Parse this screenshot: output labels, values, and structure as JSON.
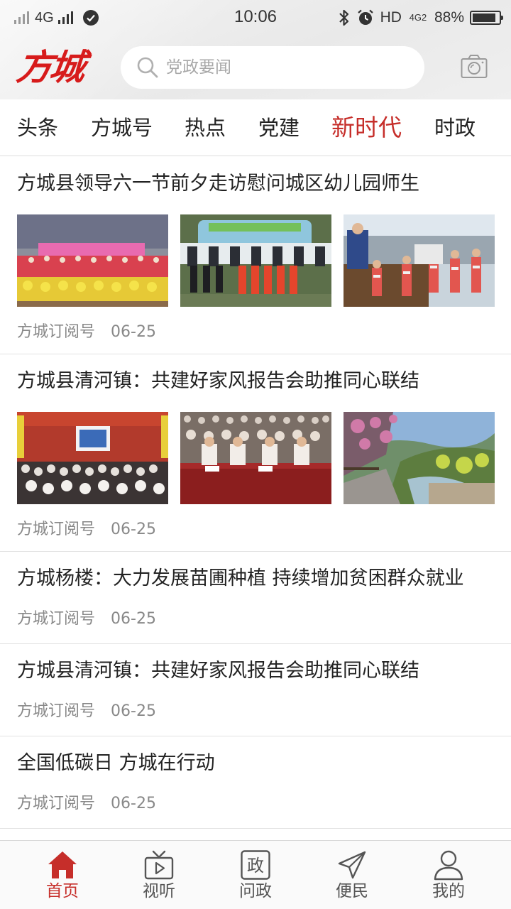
{
  "status_bar": {
    "network": "4G",
    "time": "10:06",
    "hd": "HD",
    "network2": "4G2",
    "battery_pct": "88%",
    "battery_level": 0.88
  },
  "header": {
    "logo": "方城",
    "search_placeholder": "党政要闻"
  },
  "tabs": [
    {
      "label": "头条",
      "active": false
    },
    {
      "label": "方城号",
      "active": false
    },
    {
      "label": "热点",
      "active": false
    },
    {
      "label": "党建",
      "active": false
    },
    {
      "label": "新时代",
      "active": true
    },
    {
      "label": "时政",
      "active": false
    }
  ],
  "articles": [
    {
      "title": "方城县领导六一节前夕走访慰问城区幼儿园师生",
      "source": "方城订阅号",
      "date": "06-25"
    },
    {
      "title": "方城县清河镇：共建好家风报告会助推同心联结",
      "source": "方城订阅号",
      "date": "06-25"
    },
    {
      "title": "方城杨楼：大力发展苗圃种植 持续增加贫困群众就业",
      "source": "方城订阅号",
      "date": "06-25"
    },
    {
      "title": "方城县清河镇：共建好家风报告会助推同心联结",
      "source": "方城订阅号",
      "date": "06-25"
    },
    {
      "title": "全国低碳日 方城在行动",
      "source": "方城订阅号",
      "date": "06-25"
    }
  ],
  "bottom_nav": [
    {
      "label": "首页",
      "icon": "home-icon",
      "active": true
    },
    {
      "label": "视听",
      "icon": "tv-icon",
      "active": false
    },
    {
      "label": "问政",
      "icon": "zheng-icon",
      "icon_text": "政",
      "active": false
    },
    {
      "label": "便民",
      "icon": "paper-plane-icon",
      "active": false
    },
    {
      "label": "我的",
      "icon": "user-icon",
      "active": false
    }
  ],
  "colors": {
    "accent": "#c62e2a",
    "logo": "#d71b1b"
  }
}
